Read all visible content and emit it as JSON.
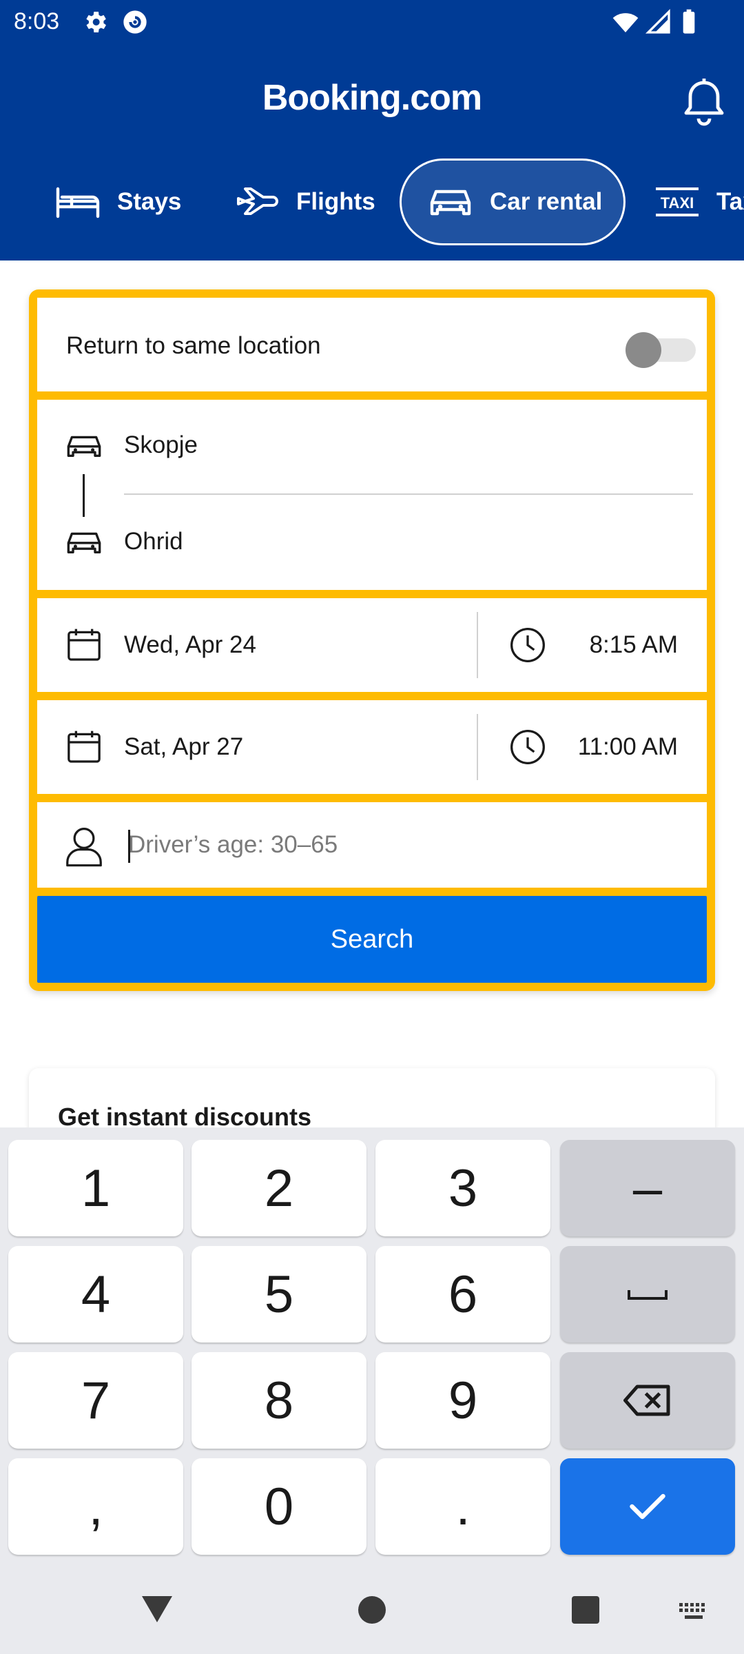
{
  "status_bar": {
    "time": "8:03"
  },
  "header": {
    "logo": "Booking.com",
    "tabs": [
      {
        "label": "Stays",
        "icon": "bed-icon"
      },
      {
        "label": "Flights",
        "icon": "plane-icon"
      },
      {
        "label": "Car rental",
        "icon": "car-icon",
        "active": true
      },
      {
        "label": "Tax",
        "icon": "taxi-icon"
      }
    ]
  },
  "form": {
    "return_same_location_label": "Return to same location",
    "return_same_location_on": false,
    "pickup_location": "Skopje",
    "dropoff_location": "Ohrid",
    "pickup_date": "Wed, Apr 24",
    "pickup_time": "8:15 AM",
    "dropoff_date": "Sat, Apr 27",
    "dropoff_time": "11:00 AM",
    "driver_age_value": "",
    "driver_age_placeholder": "Driver’s age: 30–65",
    "search_label": "Search"
  },
  "discounts": {
    "title": "Get instant discounts"
  },
  "keyboard": {
    "keys": [
      "1",
      "2",
      "3",
      "–",
      "4",
      "5",
      "6",
      "7",
      "8",
      "9",
      ",",
      "0",
      "."
    ]
  },
  "colors": {
    "header_bg": "#003b95",
    "accent_yellow": "#febb02",
    "search_blue": "#006ce4",
    "enter_blue": "#1a73e8"
  }
}
